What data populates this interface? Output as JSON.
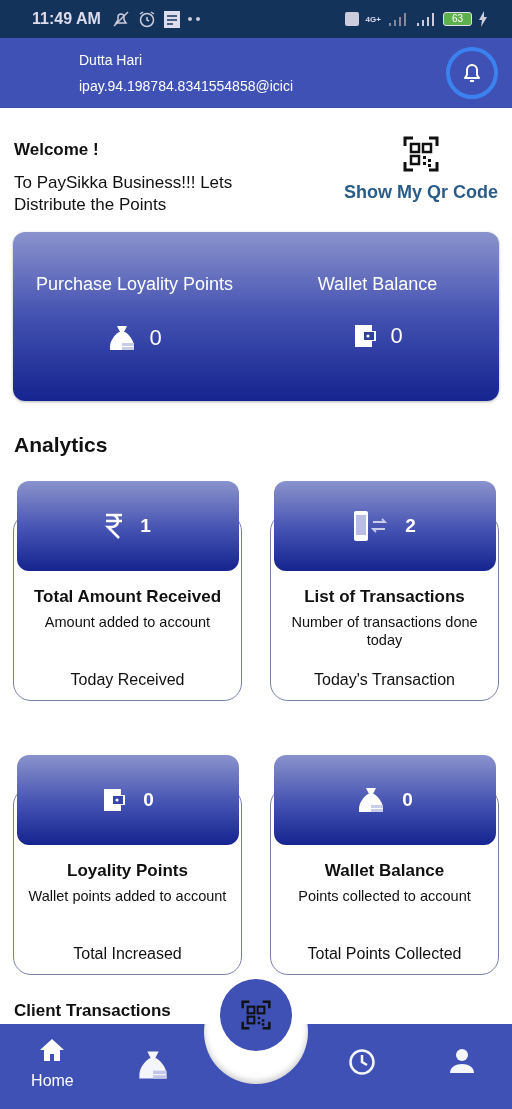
{
  "status_bar": {
    "time": "11:49 AM",
    "network": "4G+",
    "battery": "63"
  },
  "header": {
    "name": "Dutta Hari",
    "upi_id": "ipay.94.198784.8341554858@icici"
  },
  "welcome": {
    "title": "Welcome !",
    "subtitle": "To PaySikka Business!!! Lets Distribute the Points",
    "qr_link": "Show My Qr Code"
  },
  "summary": [
    {
      "label": "Purchase Loyality Points",
      "kind": "points",
      "value": "0"
    },
    {
      "label": "Wallet Balance",
      "kind": "wallet",
      "value": "0"
    }
  ],
  "analytics_title": "Analytics",
  "analytics": [
    {
      "kind": "amount",
      "value": "1",
      "title": "Total Amount Received",
      "description": "Amount added to account",
      "footer": "Today Received"
    },
    {
      "kind": "transactions",
      "value": "2",
      "title": "List of Transactions",
      "description": "Number of transactions done today",
      "footer": "Today's Transaction"
    },
    {
      "kind": "wallet",
      "value": "0",
      "title": "Loyality Points",
      "description": "Wallet points added to account",
      "footer": "Total Increased"
    },
    {
      "kind": "points",
      "value": "0",
      "title": "Wallet Balance",
      "description": "Points collected to account",
      "footer": "Total Points Collected"
    }
  ],
  "client_transactions_title": "Client Transactions",
  "bottom_nav": [
    {
      "kind": "home",
      "label": "Home",
      "selected": true
    },
    {
      "kind": "points",
      "selected": false
    },
    {
      "kind": "history",
      "selected": false
    },
    {
      "kind": "profile",
      "selected": false
    }
  ]
}
